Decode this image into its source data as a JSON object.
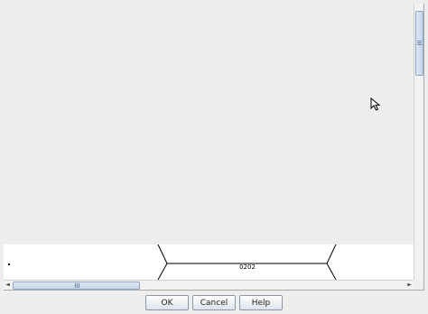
{
  "diagram": {
    "node_label": "0202"
  },
  "buttons": {
    "ok": "OK",
    "cancel": "Cancel",
    "help": "Help"
  },
  "scrollbars": {
    "left_arrow": "◄",
    "right_arrow": "►"
  }
}
